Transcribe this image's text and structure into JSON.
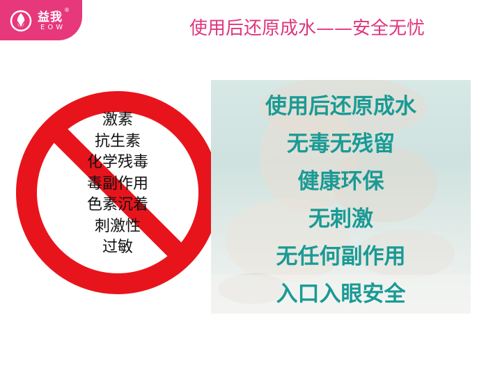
{
  "brand": {
    "name": "益我",
    "latin": "EOW",
    "registered_mark": "®",
    "logo_icon": "eow-logo-icon",
    "accent_color": "#e8387c"
  },
  "title": "使用后还原成水——安全无忧",
  "prohibited": {
    "icon": "prohibition-sign-icon",
    "color": "#e8141c",
    "items": [
      "激素",
      "抗生素",
      "化学残毒",
      "毒副作用",
      "色素沉着",
      "刺激性",
      "过敏"
    ]
  },
  "benefits": {
    "color": "#1a9a94",
    "items": [
      "使用后还原成水",
      "无毒无残留",
      "健康环保",
      "无刺激",
      "无任何副作用",
      "入口入眼安全"
    ]
  }
}
